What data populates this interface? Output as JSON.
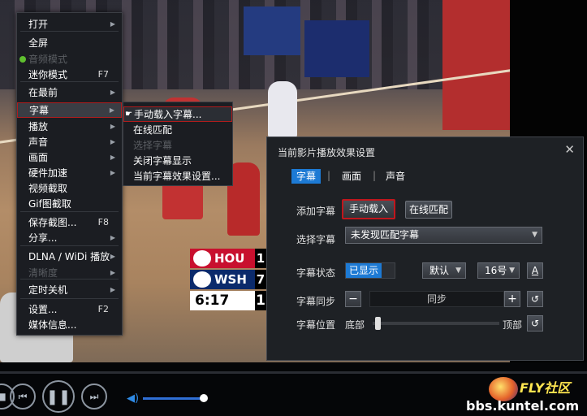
{
  "scoreboard": {
    "team1": "HOU",
    "score1": "1",
    "team2": "WSH",
    "score2": "7",
    "clock": "6:17",
    "period": "1"
  },
  "context_menu": {
    "items": [
      {
        "label": "打开",
        "shortcut": "",
        "submenu": true,
        "disabled": false
      },
      {
        "label": "全屏",
        "shortcut": "",
        "submenu": false,
        "disabled": false
      },
      {
        "label": "音频模式",
        "shortcut": "",
        "submenu": false,
        "disabled": true
      },
      {
        "label": "迷你模式",
        "shortcut": "F7",
        "submenu": false,
        "disabled": false
      },
      {
        "label": "在最前",
        "shortcut": "",
        "submenu": true,
        "disabled": false
      },
      {
        "label": "字幕",
        "shortcut": "",
        "submenu": true,
        "disabled": false,
        "selected": true
      },
      {
        "label": "播放",
        "shortcut": "",
        "submenu": true,
        "disabled": false
      },
      {
        "label": "声音",
        "shortcut": "",
        "submenu": true,
        "disabled": false
      },
      {
        "label": "画面",
        "shortcut": "",
        "submenu": true,
        "disabled": false
      },
      {
        "label": "硬件加速",
        "shortcut": "",
        "submenu": true,
        "disabled": false
      },
      {
        "label": "视频截取",
        "shortcut": "",
        "submenu": false,
        "disabled": false
      },
      {
        "label": "Gif图截取",
        "shortcut": "",
        "submenu": false,
        "disabled": false
      },
      {
        "label": "保存截图...",
        "shortcut": "F8",
        "submenu": false,
        "disabled": false
      },
      {
        "label": "分享...",
        "shortcut": "",
        "submenu": true,
        "disabled": false
      },
      {
        "label": "DLNA / WiDi 播放",
        "shortcut": "",
        "submenu": true,
        "disabled": false
      },
      {
        "label": "清晰度",
        "shortcut": "",
        "submenu": true,
        "disabled": true
      },
      {
        "label": "定时关机",
        "shortcut": "",
        "submenu": true,
        "disabled": false
      },
      {
        "label": "设置...",
        "shortcut": "F2",
        "submenu": false,
        "disabled": false
      },
      {
        "label": "媒体信息...",
        "shortcut": "",
        "submenu": false,
        "disabled": false
      }
    ]
  },
  "subtitle_submenu": {
    "items": [
      {
        "label": "手动载入字幕...",
        "disabled": false,
        "selected": true
      },
      {
        "label": "在线匹配",
        "disabled": false
      },
      {
        "label": "选择字幕",
        "disabled": true
      },
      {
        "label": "关闭字幕显示",
        "disabled": false
      },
      {
        "label": "当前字幕效果设置...",
        "disabled": false
      }
    ]
  },
  "dialog": {
    "title": "当前影片播放效果设置",
    "close": "✕",
    "tabs": [
      {
        "label": "字幕",
        "active": true
      },
      {
        "label": "画面",
        "active": false
      },
      {
        "label": "声音",
        "active": false
      }
    ],
    "add_subtitle": {
      "label": "添加字幕",
      "manual_button": "手动载入",
      "online_button": "在线匹配"
    },
    "select_subtitle": {
      "label": "选择字幕",
      "value": "未发现匹配字幕"
    },
    "subtitle_status": {
      "label": "字幕状态",
      "toggle": "已显示",
      "font": "默认",
      "size": "16号",
      "style_icon": "A"
    },
    "subtitle_sync": {
      "label": "字幕同步",
      "minus": "−",
      "value": "同步",
      "plus": "+"
    },
    "subtitle_position": {
      "label": "字幕位置",
      "bottom": "底部",
      "top": "顶部"
    }
  },
  "player": {
    "volume_level": 1.0
  },
  "watermark": {
    "text": "bbs.kuntel.com",
    "logo_text": "FLY社区"
  }
}
